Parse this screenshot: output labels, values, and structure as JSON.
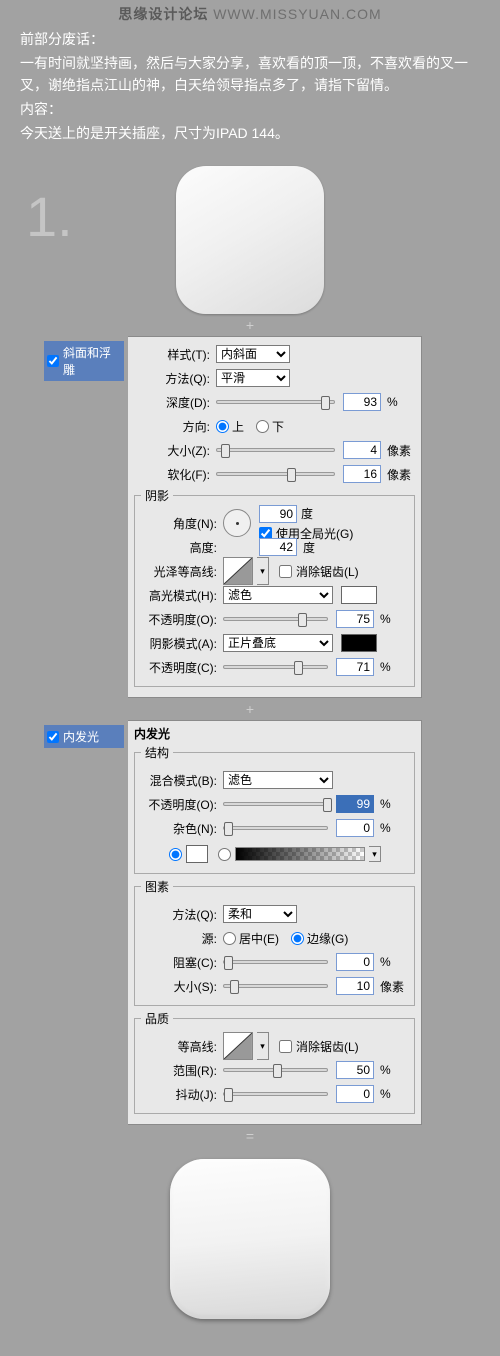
{
  "watermark": {
    "bold": "思缘设计论坛",
    "light": "WWW.MISSYUAN.COM"
  },
  "intro": {
    "l1": "前部分废话：",
    "l2": "一有时间就坚持画，然后与大家分享，喜欢看的顶一顶，不喜欢看的叉一叉，谢绝指点江山的神，白天给领导指点多了，请指下留情。",
    "l3": "内容：",
    "l4": "今天送上的是开关插座，尺寸为IPAD 144。"
  },
  "step1": "1.",
  "plus": "+",
  "equals": "=",
  "bevel": {
    "title": "斜面和浮雕",
    "style_lbl": "样式(T):",
    "style_val": "内斜面",
    "method_lbl": "方法(Q):",
    "method_val": "平滑",
    "depth_lbl": "深度(D):",
    "depth_val": "93",
    "depth_unit": "%",
    "dir_lbl": "方向:",
    "dir_up": "上",
    "dir_down": "下",
    "size_lbl": "大小(Z):",
    "size_val": "4",
    "size_unit": "像素",
    "soften_lbl": "软化(F):",
    "soften_val": "16",
    "soften_unit": "像素",
    "shade_lbl": "阴影",
    "angle_lbl": "角度(N):",
    "angle_val": "90",
    "angle_unit": "度",
    "global_lbl": "使用全局光(G)",
    "alt_lbl": "高度:",
    "alt_val": "42",
    "alt_unit": "度",
    "gloss_lbl": "光泽等高线:",
    "aa_lbl": "消除锯齿(L)",
    "hlmode_lbl": "高光模式(H):",
    "hlmode_val": "滤色",
    "hlop_lbl": "不透明度(O):",
    "hlop_val": "75",
    "pct": "%",
    "shmode_lbl": "阴影模式(A):",
    "shmode_val": "正片叠底",
    "shop_lbl": "不透明度(C):",
    "shop_val": "71"
  },
  "glow": {
    "title": "内发光",
    "struct": "结构",
    "blend_lbl": "混合模式(B):",
    "blend_val": "滤色",
    "op_lbl": "不透明度(O):",
    "op_val": "99",
    "pct": "%",
    "noise_lbl": "杂色(N):",
    "noise_val": "0",
    "elements": "图素",
    "tech_lbl": "方法(Q):",
    "tech_val": "柔和",
    "source_lbl": "源:",
    "center": "居中(E)",
    "edge": "边缘(G)",
    "choke_lbl": "阻塞(C):",
    "choke_val": "0",
    "size_lbl": "大小(S):",
    "size_val": "10",
    "size_unit": "像素",
    "quality": "品质",
    "contour_lbl": "等高线:",
    "aa_lbl": "消除锯齿(L)",
    "range_lbl": "范围(R):",
    "range_val": "50",
    "jitter_lbl": "抖动(J):",
    "jitter_val": "0"
  }
}
